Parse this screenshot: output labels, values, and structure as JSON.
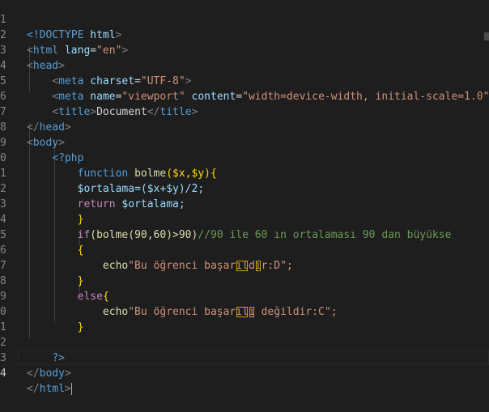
{
  "lines": [
    {
      "n": "1"
    },
    {
      "n": "2"
    },
    {
      "n": "3"
    },
    {
      "n": "4"
    },
    {
      "n": "5"
    },
    {
      "n": "6"
    },
    {
      "n": "7"
    },
    {
      "n": "8"
    },
    {
      "n": "9"
    },
    {
      "n": "0"
    },
    {
      "n": "1"
    },
    {
      "n": "2"
    },
    {
      "n": "3"
    },
    {
      "n": "4"
    },
    {
      "n": "5"
    },
    {
      "n": "6"
    },
    {
      "n": "7"
    },
    {
      "n": "8"
    },
    {
      "n": "9"
    },
    {
      "n": "0"
    },
    {
      "n": "1"
    },
    {
      "n": "2"
    },
    {
      "n": "3"
    },
    {
      "n": "4"
    }
  ],
  "code": {
    "doctype": "<!DOCTYPE",
    "doctype_html": "html",
    "html_tag": "html",
    "lang_attr": "lang",
    "lang_val": "\"en\"",
    "head_tag": "head",
    "meta_tag": "meta",
    "charset_attr": "charset",
    "charset_val": "\"UTF-8\"",
    "name_attr": "name",
    "name_val": "\"viewport\"",
    "content_attr": "content",
    "content_val": "\"width=device-width, initial-scale=1.0\"",
    "title_tag": "title",
    "title_text": "Document",
    "body_tag": "body",
    "php_open": "<?php",
    "kw_function": "function",
    "fn_name": "bolme",
    "params": "($x,$y){",
    "ortalama_assign": "$ortalama=($x+$y)/2;",
    "kw_return": "return",
    "ret_var": "$ortalama;",
    "close_brace": "}",
    "open_brace": "{",
    "kw_if": "if",
    "if_cond": "(bolme(90,60)>90)",
    "comment": "//90 ile 60 ın ortalaması 90 dan büyükse",
    "kw_echo": "echo",
    "echo1_a": "\"Bu öğrenci başar",
    "echo1_b": "ıl",
    "echo1_c": "d",
    "echo1_d": "ı",
    "echo1_e": "r:D\";",
    "kw_else": "else",
    "else_brace": "{",
    "echo2_a": "\"Bu öğrenci başar",
    "echo2_b": "ıl",
    "echo2_c": "ı",
    "echo2_d": " değildir:C\";",
    "php_close": "?>"
  },
  "colors": {
    "background": "#1e1e1e",
    "tag": "#569cd6",
    "attribute": "#9cdcfe",
    "string": "#ce9178",
    "keyword": "#c586c0",
    "function": "#dcdcaa",
    "comment": "#6a9955",
    "line_number": "#858585"
  }
}
